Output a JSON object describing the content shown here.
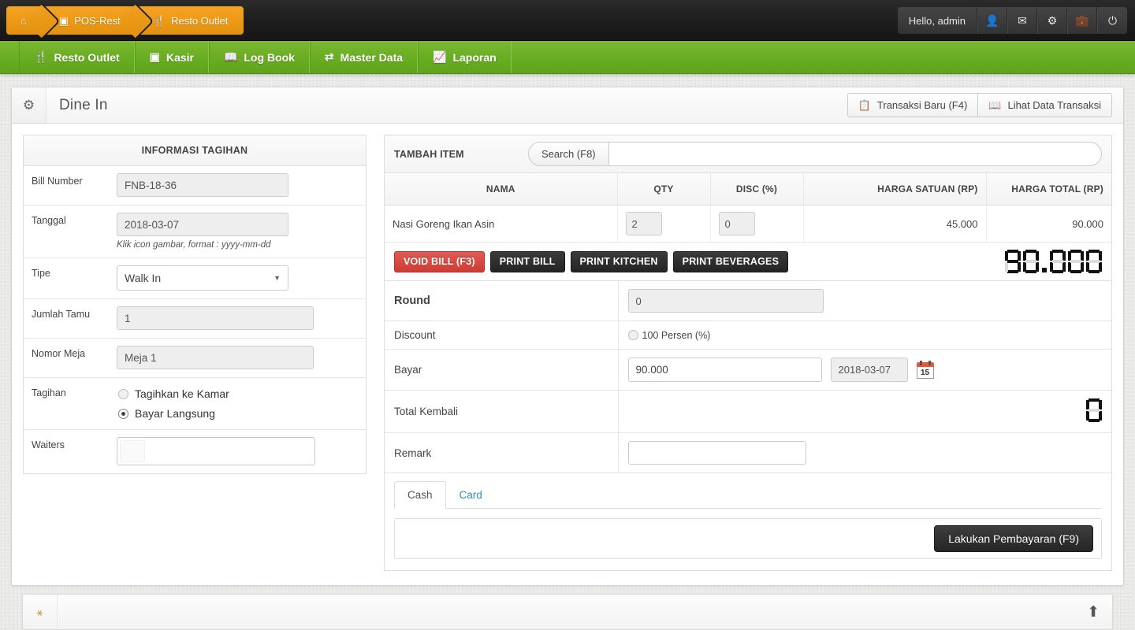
{
  "topbar": {
    "breadcrumbs": [
      {
        "icon": "home-icon",
        "glyph": "⌂",
        "label": ""
      },
      {
        "icon": "monitor-icon",
        "glyph": "☰",
        "label": "POS-Resto"
      },
      {
        "icon": "cutlery-icon",
        "glyph": "⌸",
        "label": "Resto Outlet"
      }
    ],
    "greeting": "Hello, admin",
    "icons": [
      {
        "name": "user-icon",
        "glyph": "♟"
      },
      {
        "name": "envelope-icon",
        "glyph": "✉"
      },
      {
        "name": "gear-icon",
        "glyph": "⚙"
      },
      {
        "name": "briefcase-icon",
        "glyph": "ὋC"
      },
      {
        "name": "power-icon",
        "glyph": "⏻"
      }
    ]
  },
  "nav": {
    "items": [
      {
        "label": "Resto Outlet",
        "icon": "cutlery-icon",
        "glyph": "⌸"
      },
      {
        "label": "Kasir",
        "icon": "cash-register-icon",
        "glyph": "▣"
      },
      {
        "label": "Log Book",
        "icon": "book-icon",
        "glyph": "▮"
      },
      {
        "label": "Master Data",
        "icon": "exchange-icon",
        "glyph": "⇄"
      },
      {
        "label": "Laporan",
        "icon": "chart-icon",
        "glyph": "ὌA"
      }
    ]
  },
  "panel": {
    "gear_icon": "gear-icon",
    "title": "Dine In",
    "buttons": [
      {
        "label": "Transaksi Baru (F4)",
        "icon": "new-document-icon",
        "glyph": "὜E"
      },
      {
        "label": "Lihat Data Transaksi",
        "icon": "book-open-icon",
        "glyph": "Ὅ6"
      }
    ]
  },
  "bill_info": {
    "title": "INFORMASI TAGIHAN",
    "bill_number_label": "Bill Number",
    "bill_number_value": "FNB-18-36",
    "tanggal_label": "Tanggal",
    "tanggal_value": "2018-03-07",
    "tanggal_hint": "Klik icon gambar, format : yyyy-mm-dd",
    "tipe_label": "Tipe",
    "tipe_value": "Walk In",
    "jumlah_tamu_label": "Jumlah Tamu",
    "jumlah_tamu_value": "1",
    "nomor_meja_label": "Nomor Meja",
    "nomor_meja_value": "Meja 1",
    "tagihan_label": "Tagihan",
    "tagihan_option_1": "Tagihkan ke Kamar",
    "tagihan_option_2": "Bayar Langsung",
    "tagihan_selected": "Bayar Langsung",
    "waiters_label": "Waiters",
    "waiters_value": ""
  },
  "items_panel": {
    "title": "TAMBAH ITEM",
    "search_button": "Search (F8)",
    "search_value": "",
    "search_placeholder": "",
    "columns": [
      "NAMA",
      "QTY",
      "DISC (%)",
      "HARGA SATUAN (RP)",
      "HARGA TOTAL (RP)"
    ],
    "rows": [
      {
        "nama": "Nasi Goreng Ikan Asin",
        "qty": "2",
        "disc": "0",
        "harga_satuan": "45.000",
        "harga_total": "90.000"
      }
    ],
    "actions": [
      {
        "label": "VOID BILL (F3)",
        "style": "red"
      },
      {
        "label": "PRINT BILL",
        "style": "dark"
      },
      {
        "label": "PRINT KITCHEN",
        "style": "dark"
      },
      {
        "label": "PRINT BEVERAGES",
        "style": "dark"
      }
    ],
    "grand_total": "90.000"
  },
  "payment": {
    "round_label": "Round",
    "round_value": "0",
    "discount_label": "Discount",
    "discount_option": "100 Persen (%)",
    "bayar_label": "Bayar",
    "bayar_value": "90.000",
    "bayar_date": "2018-03-07",
    "calendar_icon": "calendar-icon",
    "calendar_day": "15",
    "total_kembali_label": "Total Kembali",
    "total_kembali_value": "0",
    "remark_label": "Remark",
    "remark_value": "",
    "tabs": [
      {
        "label": "Cash",
        "active": true
      },
      {
        "label": "Card",
        "active": false
      }
    ],
    "pay_button": "Lakukan Pembayaran (F9)"
  },
  "footer": {
    "left_icon": "key-icon",
    "left_glyph": "⚷",
    "scroll_top_icon": "arrow-up-icon",
    "scroll_top_glyph": "⬆"
  },
  "colors": {
    "orange": "#ed9a15",
    "green": "#6aae24",
    "dark": "#242424",
    "red": "#d03b33",
    "link_blue": "#2a8fbd"
  }
}
